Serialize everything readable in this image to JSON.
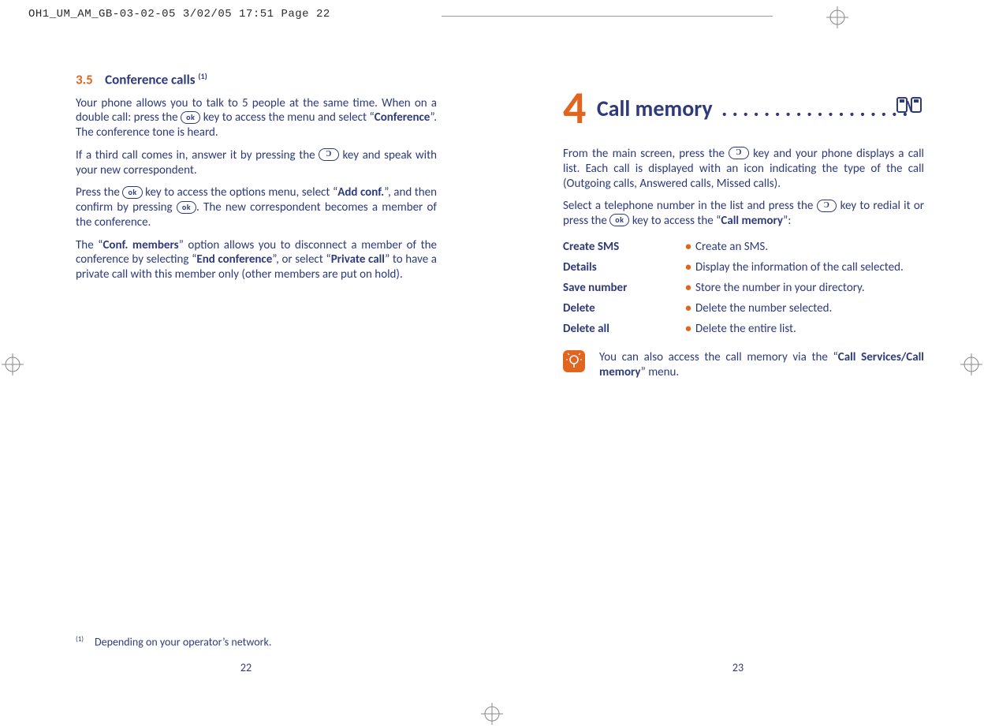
{
  "printhead": "OH1_UM_AM_GB-03-02-05   3/02/05  17:51  Page 22",
  "left": {
    "sec_num": "3.5",
    "sec_title": "Conference calls ",
    "sec_fn": "(1)",
    "p1a": "Your phone allows you to talk to 5 people at the same time. When on a double call: press the ",
    "p1b": " key to access the menu and select “",
    "p1c_bold": "Conference",
    "p1d": "”. The conference tone is heard.",
    "p2a": "If a third call comes in, answer it by pressing the ",
    "p2b": " key and speak with your new correspondent.",
    "p3a": "Press the ",
    "p3b": " key to access the options menu, select “",
    "p3c_bold": "Add conf.",
    "p3d": "”, and then confirm by pressing ",
    "p3e": ". The new correspondent becomes a member of the conference.",
    "p4a": "The “",
    "p4b_bold": "Conf. members",
    "p4c": "” option allows you to disconnect a member of the conference by selecting “",
    "p4d_bold": "End conference",
    "p4e": "”, or select “",
    "p4f_bold": "Private call",
    "p4g": "” to have a private call with this member only (other members are put on hold).",
    "footnote_mark": "(1)",
    "footnote_text": "Depending on your operator’s network.",
    "pagenum": "22"
  },
  "right": {
    "chap_num": "4",
    "chap_title": "Call memory",
    "dots": "..................",
    "p1a": "From the main screen, press the ",
    "p1b": " key and your phone displays a call list. Each call is displayed with an icon indicating the type of the call (Outgoing calls, Answered calls, Missed calls).",
    "p2a": "Select a telephone number in the list and press the ",
    "p2b": " key to redial it or press the ",
    "p2c": " key to access the “",
    "p2d_bold": "Call memory",
    "p2e": "”:",
    "defs": [
      {
        "term": "Create SMS",
        "desc": "Create an SMS."
      },
      {
        "term": "Details",
        "desc": "Display the information of the call selected."
      },
      {
        "term": "Save number",
        "desc": "Store the number in your directory."
      },
      {
        "term": "Delete",
        "desc": "Delete the number selected."
      },
      {
        "term": "Delete all",
        "desc": "Delete the entire list."
      }
    ],
    "tip_a": "You can also access the call memory via the “",
    "tip_b_bold": "Call Services/Call memory",
    "tip_c": "” menu.",
    "pagenum": "23"
  },
  "keys": {
    "ok": "ok",
    "c": "Ɔ"
  }
}
